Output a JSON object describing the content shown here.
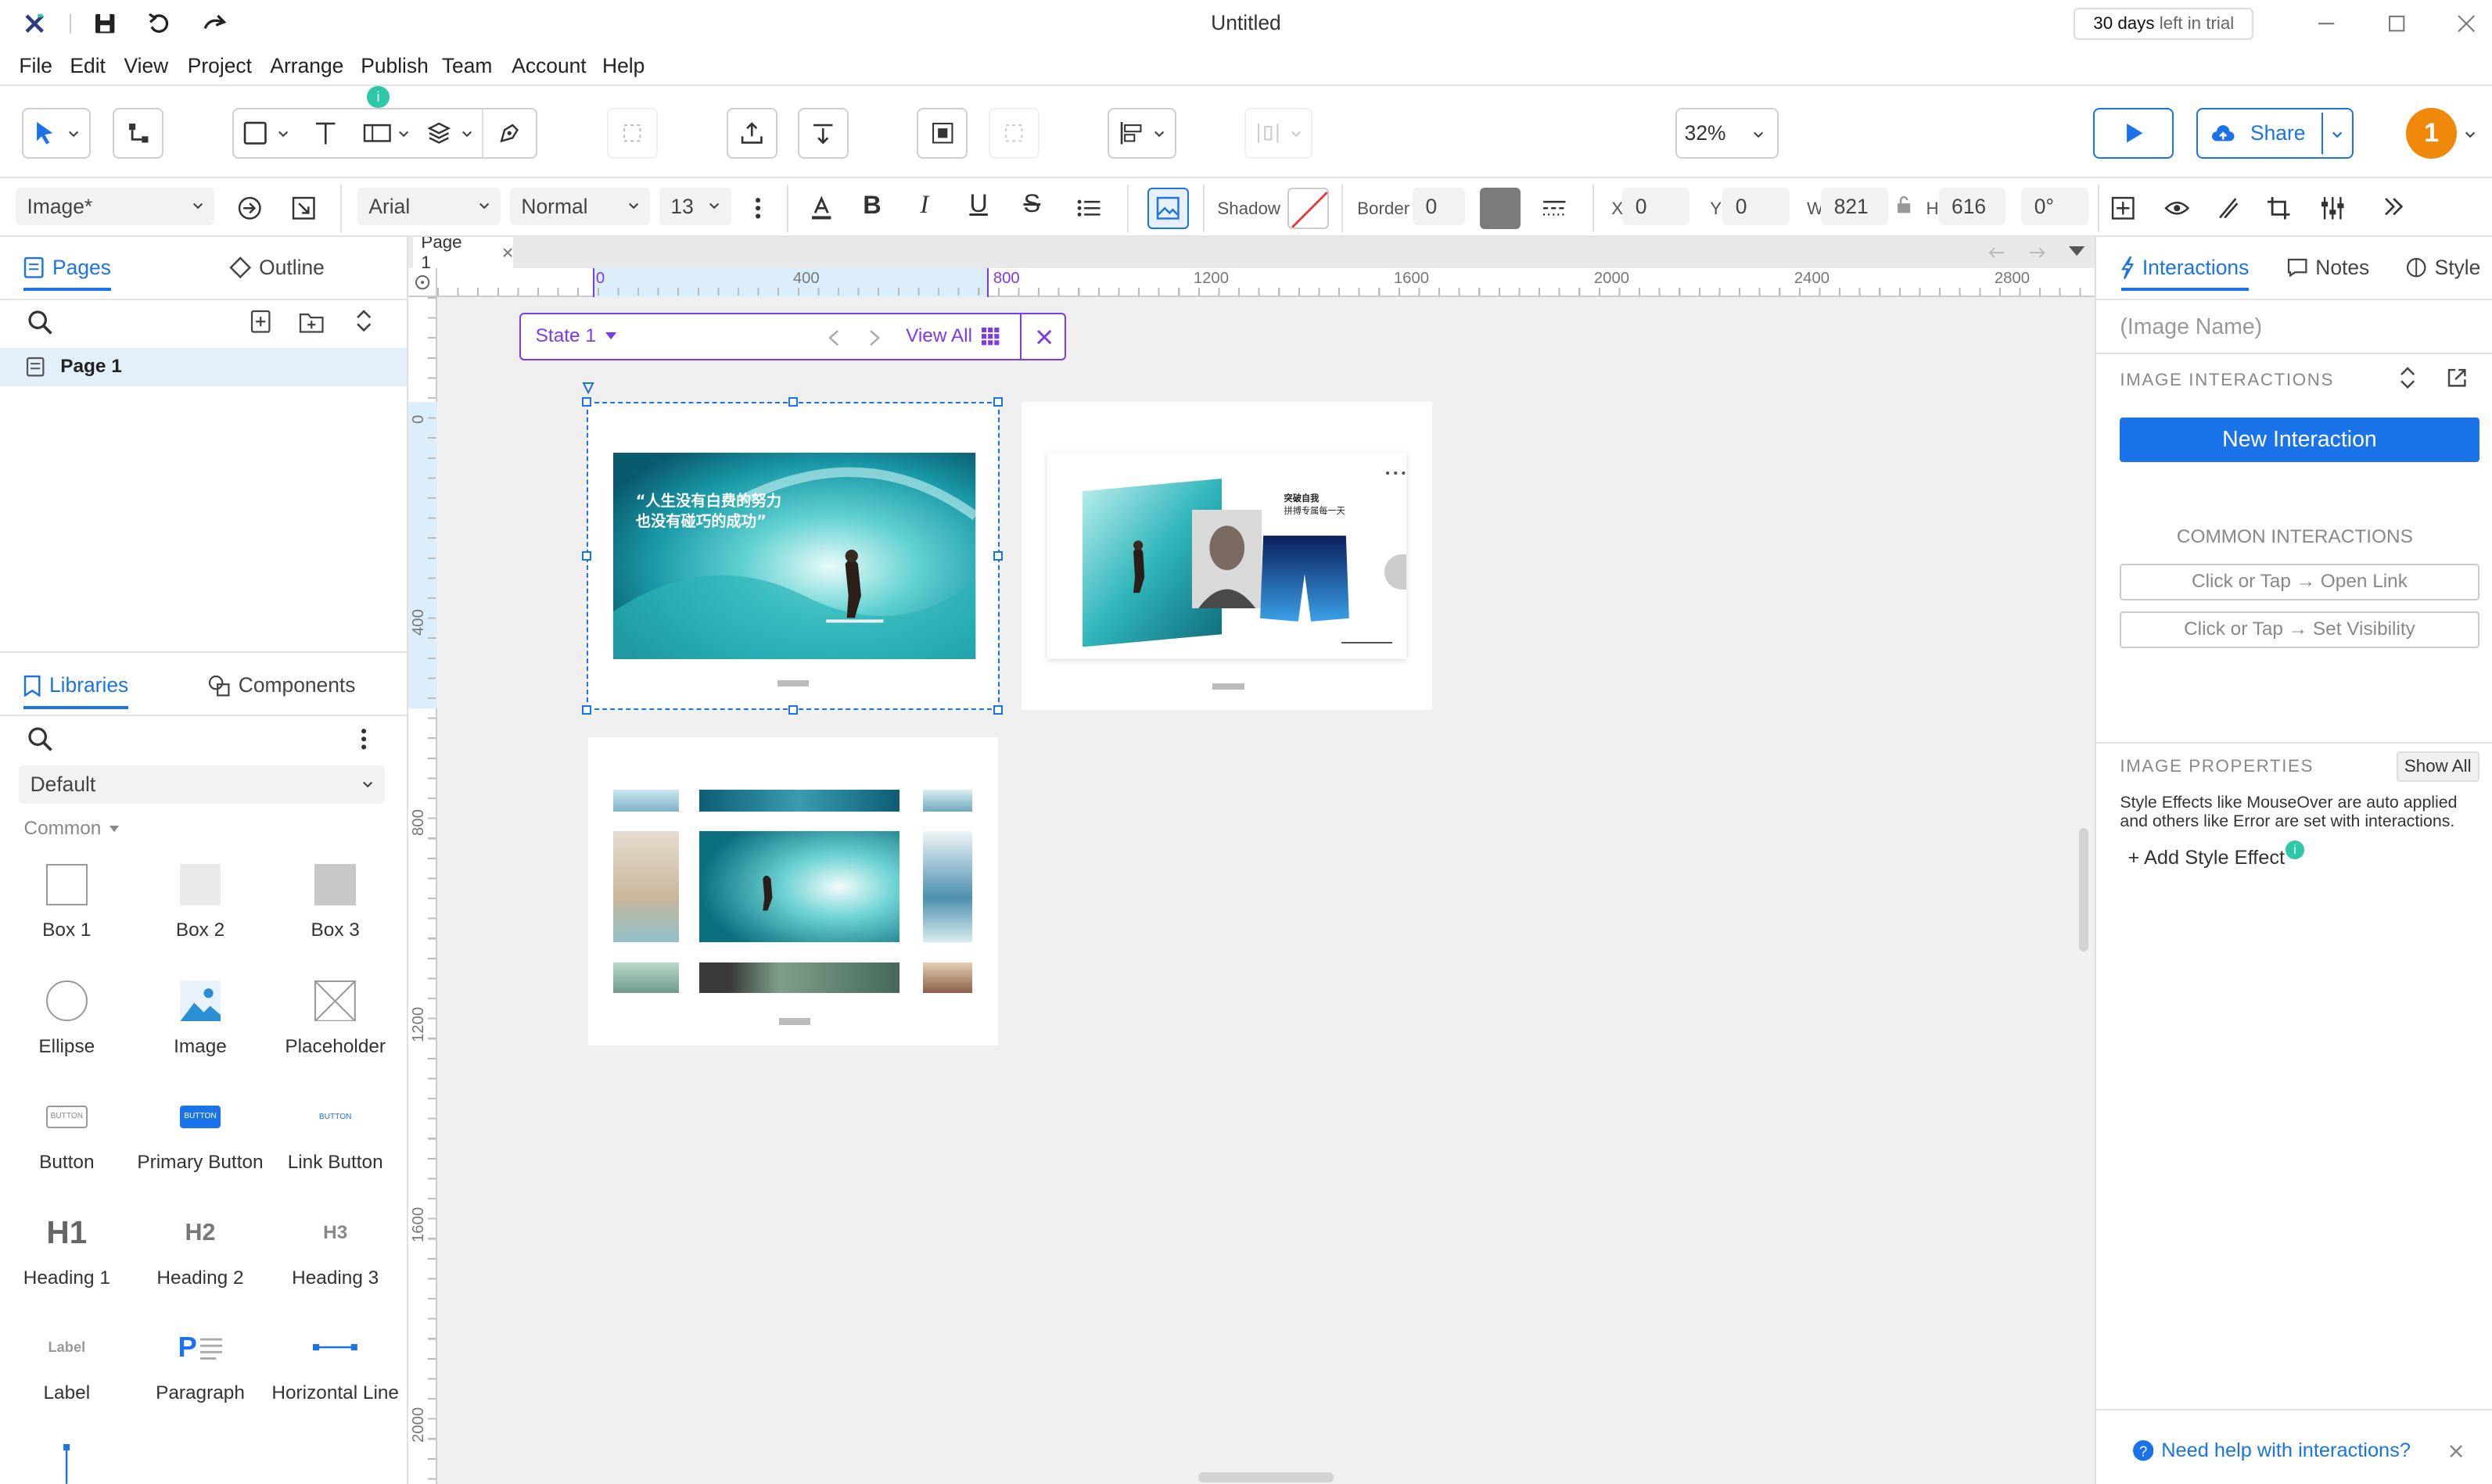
{
  "window": {
    "title": "Untitled",
    "trial": {
      "days": "30 days",
      "rest": "left in trial"
    }
  },
  "menu": [
    "File",
    "Edit",
    "View",
    "Project",
    "Arrange",
    "Publish",
    "Team",
    "Account",
    "Help"
  ],
  "toolbar": {
    "zoom": "32%",
    "share_label": "Share",
    "avatar_initial": "1",
    "badge": "i"
  },
  "format": {
    "style_select": "Image*",
    "font_family": "Arial",
    "font_weight": "Normal",
    "font_size": "13",
    "shadow_label": "Shadow",
    "border_label": "Border",
    "border_value": "0",
    "x_label": "X",
    "x_value": "0",
    "y_label": "Y",
    "y_value": "0",
    "w_label": "W",
    "w_value": "821",
    "h_label": "H",
    "h_value": "616",
    "rotation": "0°",
    "fill_color": "#7b7b7b"
  },
  "left": {
    "tabs": {
      "pages": "Pages",
      "outline": "Outline"
    },
    "pages": [
      {
        "label": "Page 1"
      }
    ],
    "lib_tabs": {
      "libraries": "Libraries",
      "components": "Components"
    },
    "library_select": "Default",
    "group": "Common",
    "widgets": [
      {
        "label": "Box 1",
        "icon": "box1-icon"
      },
      {
        "label": "Box 2",
        "icon": "box2-icon"
      },
      {
        "label": "Box 3",
        "icon": "box3-icon"
      },
      {
        "label": "Ellipse",
        "icon": "ellipse-icon"
      },
      {
        "label": "Image",
        "icon": "image-icon"
      },
      {
        "label": "Placeholder",
        "icon": "placeholder-icon"
      },
      {
        "label": "Button",
        "icon": "button-icon",
        "text": "BUTTON"
      },
      {
        "label": "Primary Button",
        "icon": "primary-button-icon",
        "text": "BUTTON"
      },
      {
        "label": "Link Button",
        "icon": "link-button-icon",
        "text": "BUTTON"
      },
      {
        "label": "Heading 1",
        "icon": "heading1-icon",
        "text": "H1"
      },
      {
        "label": "Heading 2",
        "icon": "heading2-icon",
        "text": "H2"
      },
      {
        "label": "Heading 3",
        "icon": "heading3-icon",
        "text": "H3"
      },
      {
        "label": "Label",
        "icon": "label-icon",
        "text": "Label"
      },
      {
        "label": "Paragraph",
        "icon": "paragraph-icon",
        "text": "P"
      },
      {
        "label": "Horizontal Line",
        "icon": "hline-icon"
      }
    ]
  },
  "canvas": {
    "page_tab": "Page 1",
    "state": {
      "label": "State 1",
      "view_all": "View All"
    },
    "ruler_top": [
      "0",
      "400",
      "800",
      "1200",
      "1600",
      "2000",
      "2400",
      "2800"
    ],
    "ruler_left": [
      "0",
      "400",
      "800",
      "1200",
      "1600",
      "2000"
    ],
    "slide1": {
      "quote_line1": "“人生没有白费的努力",
      "quote_line2": "也没有碰巧的成功”"
    },
    "slide2": {
      "heading_line1": "突破自我",
      "heading_line2": "拼搏专属每一天"
    }
  },
  "right": {
    "tabs": {
      "interactions": "Interactions",
      "notes": "Notes",
      "style": "Style"
    },
    "image_name_placeholder": "(Image Name)",
    "image_interactions": "IMAGE INTERACTIONS",
    "new_interaction": "New Interaction",
    "common_interactions": "COMMON INTERACTIONS",
    "common": [
      "Click or Tap → Open Link",
      "Click or Tap → Set Visibility"
    ],
    "image_properties": "IMAGE PROPERTIES",
    "show_all": "Show All",
    "props_desc": "Style Effects like MouseOver are auto applied and others like Error are set with interactions.",
    "add_style_effect": "+ Add Style Effect",
    "help": "Need help with interactions?"
  },
  "colors": {
    "accent": "#1a73e8",
    "state_purple": "#7c3aed",
    "badge_green": "#2ec7a7",
    "avatar_orange": "#f0880a"
  }
}
